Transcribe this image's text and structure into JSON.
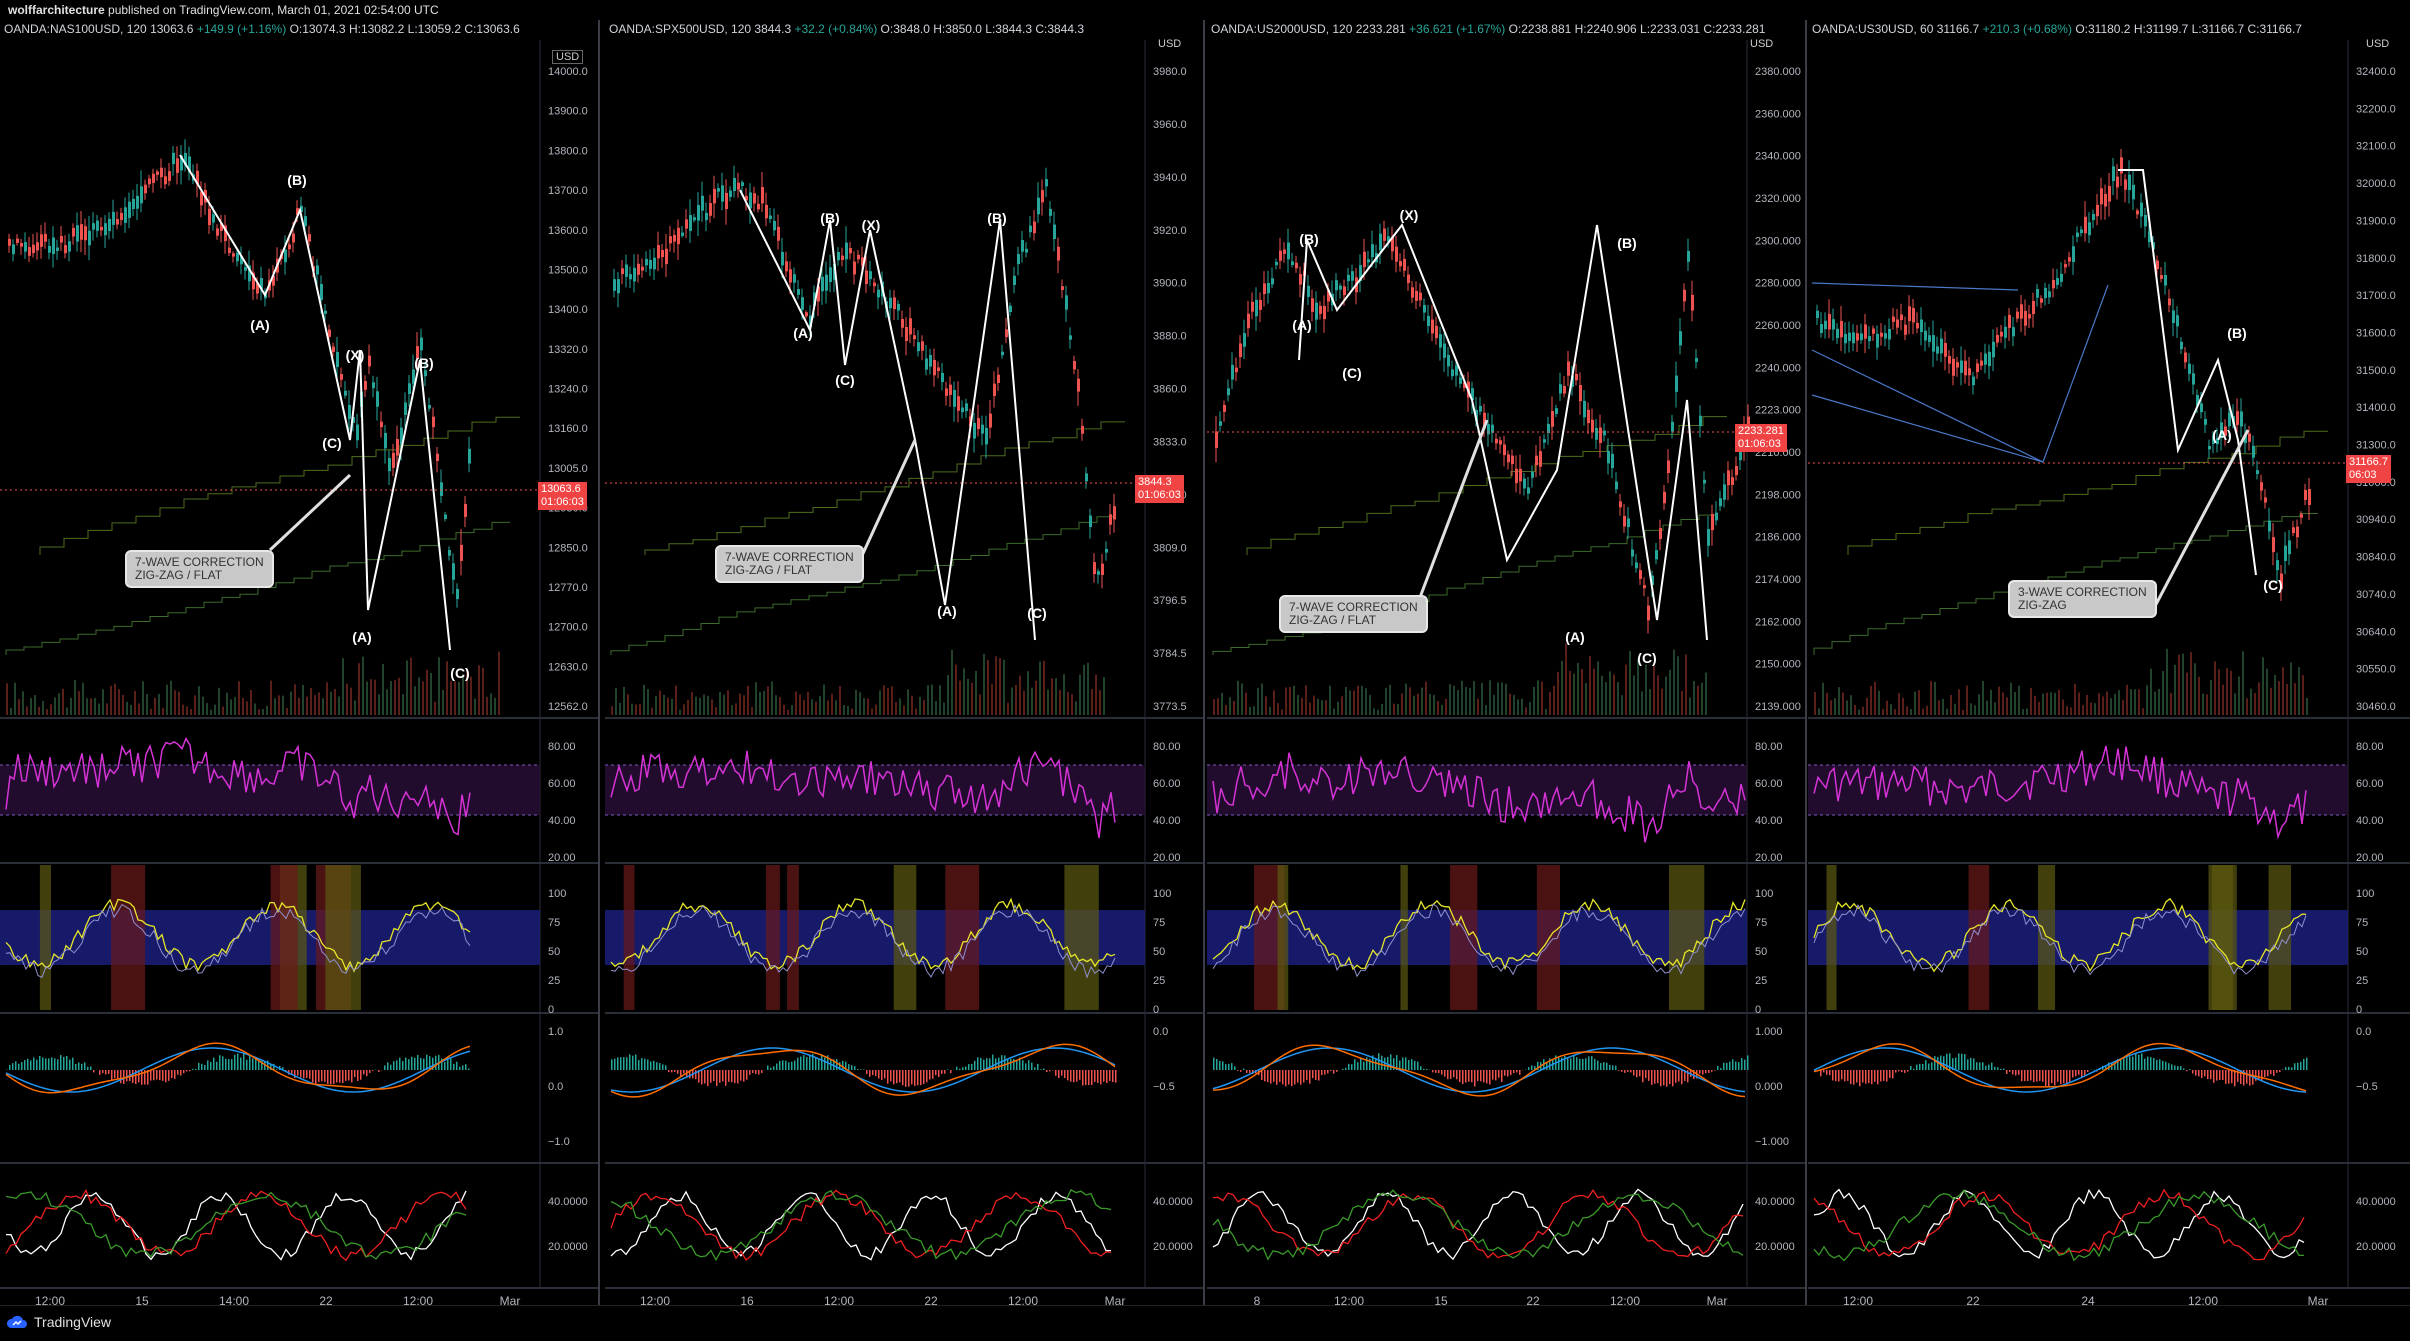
{
  "publisher": {
    "user": "wolffarchitecture",
    "text": " published on TradingView.com, March 01, 2021 02:54:00 UTC"
  },
  "footer": {
    "brand": "TradingView"
  },
  "panels": [
    {
      "symbol": "OANDA:NAS100USD, 120",
      "last": "13063.6",
      "change": "+149.9 (+1.16%)",
      "ohlc": "O:13074.3 H:13082.2 L:13059.2 C:13063.6",
      "currency_label": "USD",
      "price_tag": "13063.6",
      "countdown": "01:06:03",
      "price_axis": [
        "14000.0",
        "13900.0",
        "13800.0",
        "13700.0",
        "13600.0",
        "13500.0",
        "13400.0",
        "13320.0",
        "13240.0",
        "13160.0",
        "13005.0",
        "12930.0",
        "12850.0",
        "12770.0",
        "12700.0",
        "12630.0",
        "12562.0"
      ],
      "rsi_axis": [
        "80.00",
        "60.00",
        "40.00",
        "20.00"
      ],
      "stoch_axis": [
        "100",
        "75",
        "50",
        "25",
        "0"
      ],
      "macd_axis": [
        "1.0",
        "0.0",
        "−1.0"
      ],
      "dmi_axis": [
        "40.0000",
        "20.0000"
      ],
      "time_axis": [
        "12:00",
        "15",
        "14:00",
        "22",
        "12:00",
        "Mar"
      ],
      "annotation": "7-WAVE CORRECTION\nZIG-ZAG / FLAT",
      "wave_labels": [
        "(B)",
        "(A)",
        "(X)",
        "(C)",
        "(B)",
        "(A)",
        "(C)"
      ]
    },
    {
      "symbol": "OANDA:SPX500USD, 120",
      "last": "3844.3",
      "change": "+32.2 (+0.84%)",
      "ohlc": "O:3848.0 H:3850.0 L:3844.3 C:3844.3",
      "currency_label": "USD",
      "price_tag": "3844.3",
      "countdown": "01:06:03",
      "price_axis": [
        "3980.0",
        "3960.0",
        "3940.0",
        "3920.0",
        "3900.0",
        "3880.0",
        "3860.0",
        "3833.0",
        "3821.0",
        "3809.0",
        "3796.5",
        "3784.5",
        "3773.5"
      ],
      "rsi_axis": [
        "80.00",
        "60.00",
        "40.00",
        "20.00"
      ],
      "stoch_axis": [
        "100",
        "75",
        "50",
        "25",
        "0"
      ],
      "macd_axis": [
        "0.0",
        "−0.5"
      ],
      "dmi_axis": [
        "40.0000",
        "20.0000"
      ],
      "time_axis": [
        "12:00",
        "16",
        "12:00",
        "22",
        "12:00",
        "Mar"
      ],
      "annotation": "7-WAVE CORRECTION\nZIG-ZAG / FLAT",
      "wave_labels": [
        "(B)",
        "(X)",
        "(A)",
        "(C)",
        "(B)",
        "(A)",
        "(C)"
      ]
    },
    {
      "symbol": "OANDA:US2000USD, 120",
      "last": "2233.281",
      "change": "+36.621 (+1.67%)",
      "ohlc": "O:2238.881 H:2240.906 L:2233.031 C:2233.281",
      "currency_label": "USD",
      "price_tag": "2233.281",
      "countdown": "01:06:03",
      "price_axis": [
        "2380.000",
        "2360.000",
        "2340.000",
        "2320.000",
        "2300.000",
        "2280.000",
        "2260.000",
        "2240.000",
        "2223.000",
        "2210.000",
        "2198.000",
        "2186.000",
        "2174.000",
        "2162.000",
        "2150.000",
        "2139.000"
      ],
      "rsi_axis": [
        "80.00",
        "60.00",
        "40.00",
        "20.00"
      ],
      "stoch_axis": [
        "100",
        "75",
        "50",
        "25",
        "0"
      ],
      "macd_axis": [
        "1.000",
        "0.000",
        "−1.000"
      ],
      "dmi_axis": [
        "40.0000",
        "20.0000"
      ],
      "time_axis": [
        "8",
        "12:00",
        "15",
        "22",
        "12:00",
        "Mar"
      ],
      "annotation": "7-WAVE CORRECTION\nZIG-ZAG / FLAT",
      "wave_labels": [
        "(B)",
        "(X)",
        "(A)",
        "(C)",
        "(B)",
        "(A)",
        "(C)"
      ]
    },
    {
      "symbol": "OANDA:US30USD, 60",
      "last": "31166.7",
      "change": "+210.3 (+0.68%)",
      "ohlc": "O:31180.2 H:31199.7 L:31166.7 C:31166.7",
      "currency_label": "USD",
      "price_tag": "31166.7",
      "countdown": "06:03",
      "price_axis": [
        "32400.0",
        "32200.0",
        "32100.0",
        "32000.0",
        "31900.0",
        "31800.0",
        "31700.0",
        "31600.0",
        "31500.0",
        "31400.0",
        "31300.0",
        "31060.0",
        "30940.0",
        "30840.0",
        "30740.0",
        "30640.0",
        "30550.0",
        "30460.0"
      ],
      "rsi_axis": [
        "80.00",
        "60.00",
        "40.00",
        "20.00"
      ],
      "stoch_axis": [
        "100",
        "75",
        "50",
        "25",
        "0"
      ],
      "macd_axis": [
        "0.0",
        "−0.5"
      ],
      "dmi_axis": [
        "40.0000",
        "20.0000"
      ],
      "time_axis": [
        "12:00",
        "22",
        "24",
        "12:00",
        "Mar"
      ],
      "annotation": "3-WAVE CORRECTION\nZIG-ZAG",
      "wave_labels": [
        "(B)",
        "(A)",
        "(C)"
      ]
    }
  ]
}
